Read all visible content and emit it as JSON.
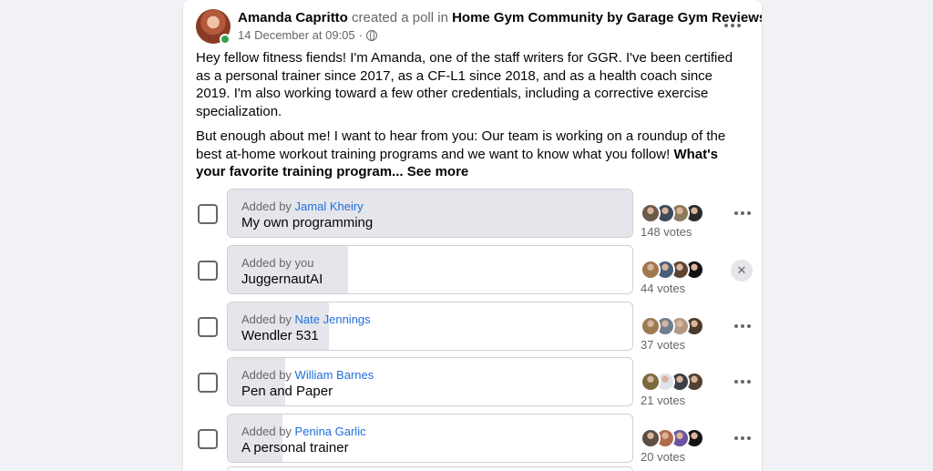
{
  "post": {
    "author": "Amanda Capritto",
    "action": "created a poll in",
    "group": "Home Gym Community by Garage Gym Reviews",
    "period": ".",
    "timestamp": "14 December at 09:05",
    "separator": "·",
    "privacy_icon": "globe-icon",
    "paragraph1": "Hey fellow fitness fiends! I'm Amanda, one of the staff writers for GGR. I've been certified as a personal trainer since 2017, as a CF-L1 since 2018, and as a health coach since 2019. I'm also working toward a few other credentials, including a corrective exercise specialization.",
    "paragraph2_text": "But enough about me! I want to hear from you: Our team is working on a roundup of the best at-home workout training programs and we want to know what you follow! ",
    "paragraph2_bold": "What's your favorite training program...",
    "see_more": " See more"
  },
  "poll": {
    "options": [
      {
        "added_prefix": "Added by ",
        "added_by": "Jamal Kheiry",
        "label": "My own programming",
        "votes_text": "148 votes",
        "fill": 1.0,
        "voter_colors": [
          "#6b5a4a",
          "#3d4a5c",
          "#8c7a5e",
          "#2b2b2b"
        ],
        "action": "more"
      },
      {
        "added_prefix": "Added by ",
        "added_by": "you",
        "label": "JuggernautAI",
        "votes_text": "44 votes",
        "fill": 0.297,
        "voter_colors": [
          "#a07850",
          "#4a5f7a",
          "#5c4433",
          "#111111"
        ],
        "action": "remove"
      },
      {
        "added_prefix": "Added by ",
        "added_by": "Nate Jennings",
        "label": "Wendler 531",
        "votes_text": "37 votes",
        "fill": 0.25,
        "voter_colors": [
          "#9c7b52",
          "#6f7f90",
          "#b49a86",
          "#4b3b2d"
        ],
        "action": "more"
      },
      {
        "added_prefix": "Added by ",
        "added_by": "William Barnes",
        "label": "Pen and Paper",
        "votes_text": "21 votes",
        "fill": 0.142,
        "voter_colors": [
          "#7a6a3e",
          "#dfe3ea",
          "#3a3f4a",
          "#514233"
        ],
        "action": "more"
      },
      {
        "added_prefix": "Added by ",
        "added_by": "Penina Garlic",
        "label": "A personal trainer",
        "votes_text": "20 votes",
        "fill": 0.135,
        "voter_colors": [
          "#5b4e44",
          "#b26a4a",
          "#6b55a3",
          "#141414"
        ],
        "action": "more"
      }
    ]
  },
  "colors": {
    "link": "#216fdb",
    "online": "#31a24c",
    "bar_fill": "#e4e6eb",
    "muted": "#65676b"
  }
}
